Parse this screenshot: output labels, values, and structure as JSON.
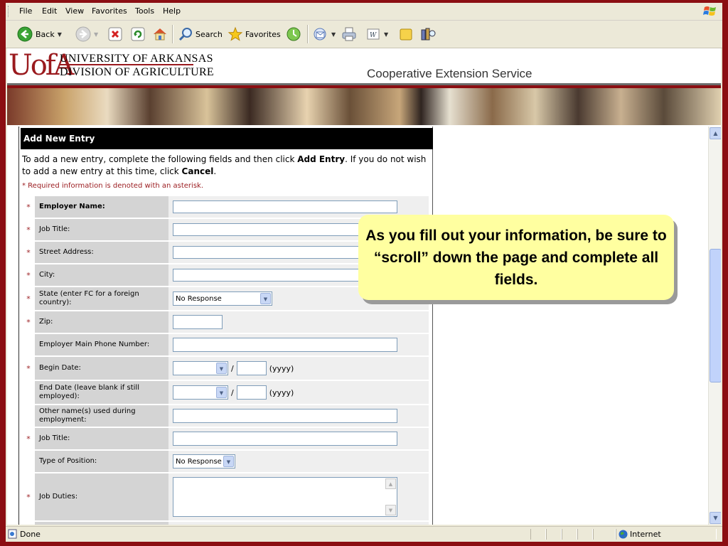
{
  "menu": [
    "File",
    "Edit",
    "View",
    "Favorites",
    "Tools",
    "Help"
  ],
  "toolbar": {
    "back": "Back",
    "search": "Search",
    "favorites": "Favorites"
  },
  "brand": {
    "logo": "UofA",
    "university": "UNIVERSITY OF ARKANSAS",
    "division": "DIVISION OF AGRICULTURE",
    "service": "Cooperative Extension Service"
  },
  "form": {
    "header": "Add New Entry",
    "intro_prefix": "To add a new entry, complete the following fields and then click ",
    "intro_add": "Add Entry",
    "intro_mid": ". If you do not wish to add a new entry at this time, click ",
    "intro_cancel": "Cancel",
    "intro_end": ".",
    "required_note": "* Required information is denoted with an asterisk.",
    "fields": [
      {
        "label": "Employer Name:",
        "required": true
      },
      {
        "label": "Job Title:",
        "required": true
      },
      {
        "label": "Street Address:",
        "required": true
      },
      {
        "label": "City:",
        "required": true
      },
      {
        "label": "State (enter FC for a foreign country):",
        "required": true,
        "value": "No Response"
      },
      {
        "label": "Zip:",
        "required": true
      },
      {
        "label": "Employer Main Phone Number:",
        "required": false
      },
      {
        "label": "Begin Date:",
        "required": true,
        "year_hint": "(yyyy)"
      },
      {
        "label": "End Date (leave blank if still employed):",
        "required": false,
        "year_hint": "(yyyy)"
      },
      {
        "label": "Other name(s) used during employment:",
        "required": false
      },
      {
        "label": "Job Title:",
        "required": true
      },
      {
        "label": "Type of Position:",
        "required": false,
        "value": "No Response"
      },
      {
        "label": "Job Duties:",
        "required": true
      }
    ],
    "slash": "/",
    "asterisk": "*"
  },
  "callout": "As you fill out your information, be sure to “scroll” down the page and complete all fields.",
  "status": {
    "text": "Done",
    "zone": "Internet"
  }
}
